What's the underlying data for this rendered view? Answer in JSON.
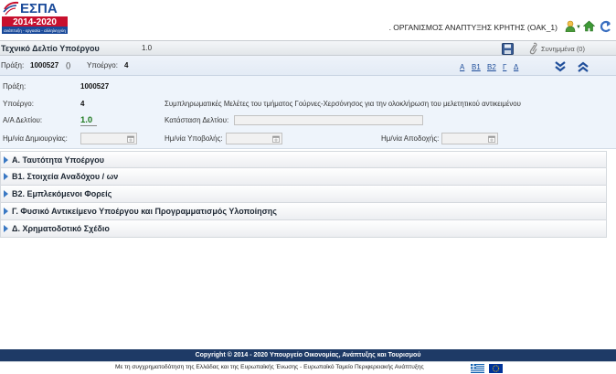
{
  "header": {
    "logo_text": "ΕΣΠΑ",
    "logo_years": "2014-2020",
    "logo_tagline": "ανάπτυξη - εργασία - αλληλεγγύη",
    "org_name": ". ΟΡΓΑΝΙΣΜΟΣ ΑΝΑΠΤΥΞΗΣ ΚΡΗΤΗΣ (OAK_1)"
  },
  "titlebar": {
    "title": "Τεχνικό Δελτίο Υποέργου",
    "version": "1.0",
    "attachments_label": "Συνημμένα (0)"
  },
  "summary": {
    "praxi_label": "Πράξη:",
    "praxi_value": "1000527",
    "praxi_extra": "()",
    "ypoergo_label": "Υποέργο:",
    "ypoergo_value": "4",
    "nav_links": [
      "Α",
      "Β1",
      "Β2",
      "Γ",
      "Δ"
    ]
  },
  "form": {
    "praxi_label": "Πράξη:",
    "praxi_value": "1000527",
    "ypoergo_label": "Υποέργο:",
    "ypoergo_value": "4",
    "ypoergo_desc": "Συμπληρωματικές Μελέτες του τμήματος Γούρνες-Χερσόνησος για την ολοκλήρωση του μελετητικού αντικειμένου",
    "aa_label": "Α/Α Δελτίου:",
    "aa_value": "1.0",
    "katastasi_label": "Κατάσταση Δελτίου:",
    "katastasi_value": "",
    "dimiourgia_label": "Ημ/νία Δημιουργίας:",
    "ypovoli_label": "Ημ/νία Υποβολής:",
    "apodoxi_label": "Ημ/νία Αποδοχής:"
  },
  "sections": [
    "Α. Ταυτότητα Υποέργου",
    "Β1. Στοιχεία Αναδόχου / ων",
    "Β2. Εμπλεκόμενοι Φορείς",
    "Γ. Φυσικό Αντικείμενο Υποέργου και Προγραμματισμός Υλοποίησης",
    "Δ. Χρηματοδοτικό Σχέδιο"
  ],
  "footer": {
    "copyright": "Copyright © 2014 - 2020 Υπουργείο Οικονομίας, Ανάπτυξης και Τουρισμού",
    "cofinancing": "Με τη συγχρηματοδότηση της Ελλάδας και της Ευρωπαϊκής Ένωσης - Ευρωπαϊκό Ταμείο Περιφερειακής Ανάπτυξης"
  },
  "colors": {
    "accent_blue": "#1e3a66",
    "logo_red": "#c8102e",
    "logo_blue": "#1a4a9a",
    "value_green": "#1f7a1f"
  },
  "icons": {
    "user": "user-icon",
    "home": "home-icon",
    "logout": "logout-icon",
    "save": "save-icon",
    "attach": "paperclip-icon",
    "expand_all": "double-chevron-down-icon",
    "collapse_all": "double-chevron-up-icon"
  }
}
